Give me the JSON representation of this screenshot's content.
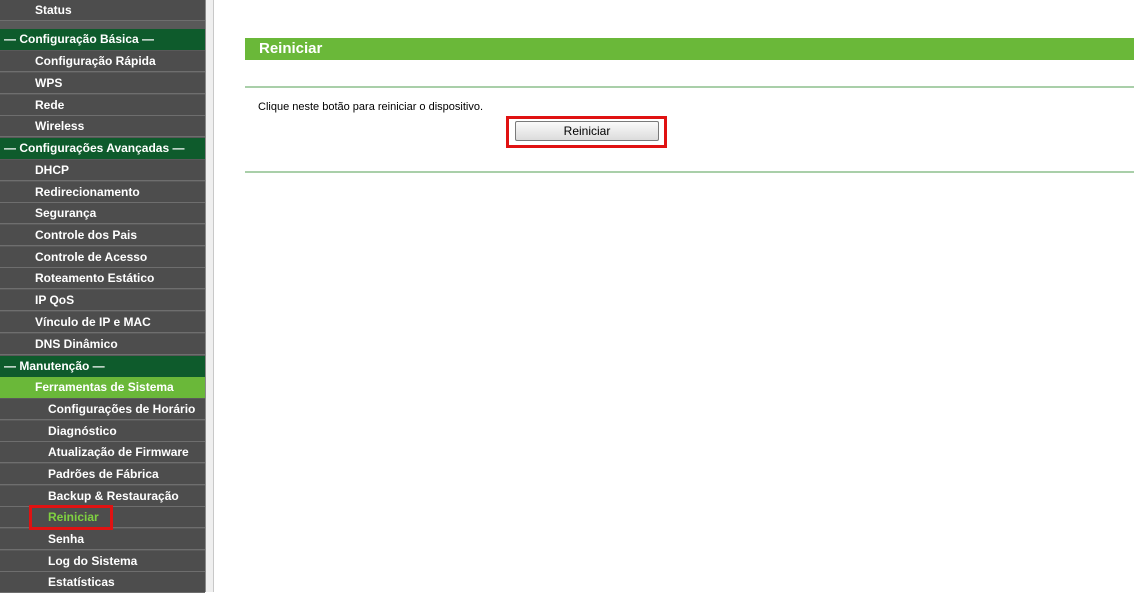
{
  "sidebar": {
    "items": [
      {
        "label": "Status",
        "kind": "item"
      },
      {
        "label": "— Configuração Básica —",
        "kind": "sect"
      },
      {
        "label": "Configuração Rápida",
        "kind": "item"
      },
      {
        "label": "WPS",
        "kind": "item"
      },
      {
        "label": "Rede",
        "kind": "item"
      },
      {
        "label": "Wireless",
        "kind": "item"
      },
      {
        "label": "— Configurações Avançadas —",
        "kind": "sect"
      },
      {
        "label": "DHCP",
        "kind": "item"
      },
      {
        "label": "Redirecionamento",
        "kind": "item"
      },
      {
        "label": "Segurança",
        "kind": "item"
      },
      {
        "label": "Controle dos Pais",
        "kind": "item"
      },
      {
        "label": "Controle de Acesso",
        "kind": "item"
      },
      {
        "label": "Roteamento Estático",
        "kind": "item"
      },
      {
        "label": "IP QoS",
        "kind": "item"
      },
      {
        "label": "Vínculo de IP e MAC",
        "kind": "item"
      },
      {
        "label": "DNS Dinâmico",
        "kind": "item"
      },
      {
        "label": "— Manutenção —",
        "kind": "sect"
      },
      {
        "label": "Ferramentas de Sistema",
        "kind": "active"
      },
      {
        "label": "Configurações de Horário",
        "kind": "sub"
      },
      {
        "label": "Diagnóstico",
        "kind": "sub"
      },
      {
        "label": "Atualização de Firmware",
        "kind": "sub"
      },
      {
        "label": "Padrões de Fábrica",
        "kind": "sub"
      },
      {
        "label": "Backup & Restauração",
        "kind": "sub"
      },
      {
        "label": "Reiniciar",
        "kind": "sub-current"
      },
      {
        "label": "Senha",
        "kind": "sub"
      },
      {
        "label": "Log do Sistema",
        "kind": "sub"
      },
      {
        "label": "Estatísticas",
        "kind": "sub"
      }
    ]
  },
  "main": {
    "title": "Reiniciar",
    "description": "Clique neste botão para reiniciar o dispositivo.",
    "reboot_button": "Reiniciar"
  },
  "colors": {
    "accent_green": "#6ab839",
    "section_green": "#0e5b2c",
    "highlight_red": "#e01212"
  }
}
